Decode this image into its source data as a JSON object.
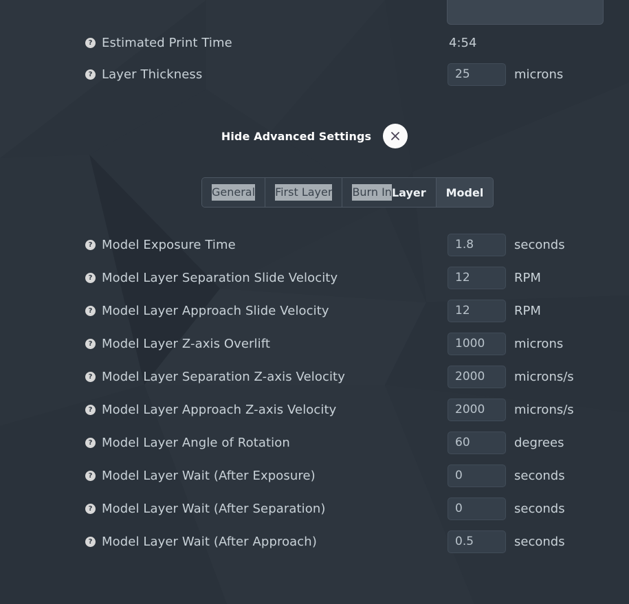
{
  "theme": {
    "page_bg": "#2b333c",
    "input_bg": "#353f4a",
    "input_border": "#414c58",
    "label_color": "#c9d2d8",
    "accent_white": "#ffffff",
    "tab_active_bg": "#3c4651",
    "selection_highlight": "#a6adb3"
  },
  "top_partial": {
    "name": "cut-off-dropdown"
  },
  "summary_rows": [
    {
      "label": "Estimated Print Time",
      "help_icon": "question-mark-icon",
      "value": "4:54",
      "unit": "",
      "type": "text"
    },
    {
      "label": "Layer Thickness",
      "help_icon": "question-mark-icon",
      "value": "25",
      "unit": "microns",
      "type": "input"
    }
  ],
  "advanced": {
    "toggle_label": "Hide Advanced Settings",
    "close_icon": "close-x-icon"
  },
  "tabs": [
    {
      "label": "General",
      "active": false,
      "selected_text": "General",
      "unselected_text": ""
    },
    {
      "label": "First Layer",
      "active": false,
      "selected_text": "First Layer",
      "unselected_text": ""
    },
    {
      "label": "Burn In Layer",
      "active": false,
      "selected_text": "Burn In ",
      "unselected_text": "Layer"
    },
    {
      "label": "Model",
      "active": true,
      "selected_text": "",
      "unselected_text": "Model"
    }
  ],
  "settings_rows": [
    {
      "label": "Model Exposure Time",
      "help_icon": "question-mark-icon",
      "value": "1.8",
      "unit": "seconds"
    },
    {
      "label": "Model Layer Separation Slide Velocity",
      "help_icon": "question-mark-icon",
      "value": "12",
      "unit": "RPM"
    },
    {
      "label": "Model Layer Approach Slide Velocity",
      "help_icon": "question-mark-icon",
      "value": "12",
      "unit": "RPM"
    },
    {
      "label": "Model Layer Z-axis Overlift",
      "help_icon": "question-mark-icon",
      "value": "1000",
      "unit": "microns"
    },
    {
      "label": "Model Layer Separation Z-axis Velocity",
      "help_icon": "question-mark-icon",
      "value": "2000",
      "unit": "microns/s"
    },
    {
      "label": "Model Layer Approach Z-axis Velocity",
      "help_icon": "question-mark-icon",
      "value": "2000",
      "unit": "microns/s"
    },
    {
      "label": "Model Layer Angle of Rotation",
      "help_icon": "question-mark-icon",
      "value": "60",
      "unit": "degrees"
    },
    {
      "label": "Model Layer Wait (After Exposure)",
      "help_icon": "question-mark-icon",
      "value": "0",
      "unit": "seconds"
    },
    {
      "label": "Model Layer Wait (After Separation)",
      "help_icon": "question-mark-icon",
      "value": "0",
      "unit": "seconds"
    },
    {
      "label": "Model Layer Wait (After Approach)",
      "help_icon": "question-mark-icon",
      "value": "0.5",
      "unit": "seconds"
    }
  ],
  "help_glyph": "?"
}
